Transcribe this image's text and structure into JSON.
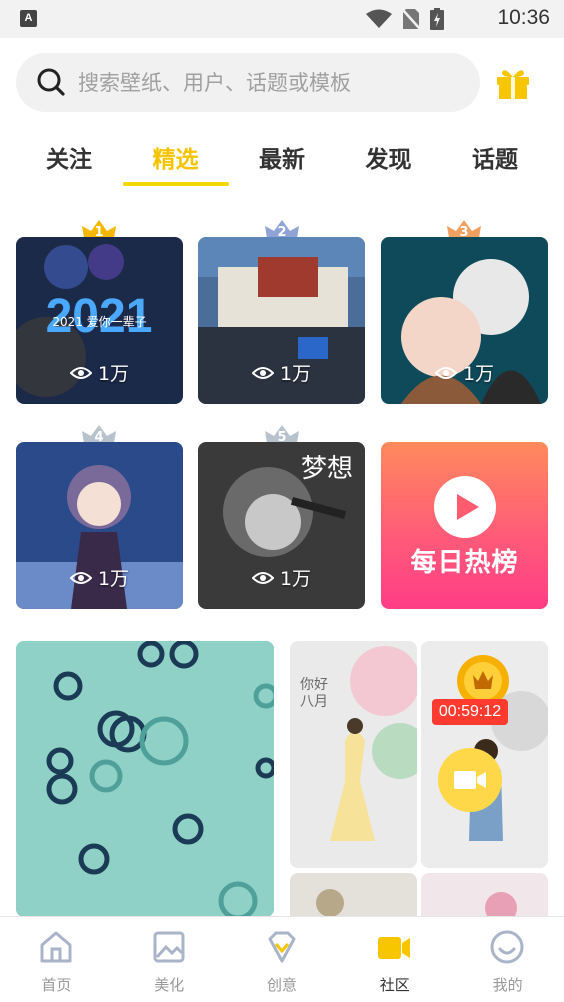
{
  "status_bar": {
    "time": "10:36",
    "left_icon_letter": "A"
  },
  "search": {
    "placeholder": "搜索壁纸、用户、话题或模板"
  },
  "tabs": [
    {
      "label": "关注",
      "active": false
    },
    {
      "label": "精选",
      "active": true
    },
    {
      "label": "最新",
      "active": false
    },
    {
      "label": "发现",
      "active": false
    },
    {
      "label": "话题",
      "active": false
    }
  ],
  "rankings": [
    {
      "rank": "1",
      "views": "1万",
      "art_text": "2021 爱你一辈子"
    },
    {
      "rank": "2",
      "views": "1万"
    },
    {
      "rank": "3",
      "views": "1万"
    },
    {
      "rank": "4",
      "views": "1万"
    },
    {
      "rank": "5",
      "views": "1万",
      "art_text": "梦想"
    }
  ],
  "hot_list": {
    "label": "每日热榜"
  },
  "feed": {
    "live_countdown": "00:59:12",
    "card_text": "你好八月"
  },
  "bottom_nav": [
    {
      "label": "首页",
      "icon": "home-icon"
    },
    {
      "label": "美化",
      "icon": "image-icon"
    },
    {
      "label": "创意",
      "icon": "diamond-icon"
    },
    {
      "label": "社区",
      "icon": "video-camera-icon",
      "active": true
    },
    {
      "label": "我的",
      "icon": "smile-icon"
    }
  ],
  "colors": {
    "accent": "#f5c400",
    "hot_gradient_start": "#ff8a5c",
    "hot_gradient_end": "#ff3d86",
    "live_red": "#ff3b30"
  }
}
